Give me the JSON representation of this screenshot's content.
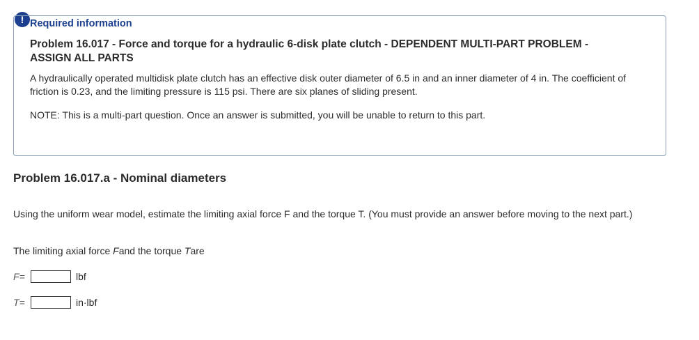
{
  "alert": {
    "icon": "exclamation-icon",
    "glyph": "!",
    "color": "#1d3f8f"
  },
  "info": {
    "required_label": "Required information",
    "problem_title": "Problem 16.017 - Force and torque for a hydraulic 6-disk plate clutch - DEPENDENT MULTI-PART PROBLEM - ASSIGN ALL PARTS",
    "description": "A hydraulically operated multidisk plate clutch has an effective disk outer diameter of 6.5 in and an inner diameter of 4 in. The coefficient of friction is 0.23, and the limiting pressure is 115 psi. There are six planes of sliding present.",
    "note": "NOTE: This is a multi-part question. Once an answer is submitted, you will be unable to return to this part."
  },
  "part": {
    "title": "Problem 16.017.a - Nominal diameters",
    "question": "Using the uniform wear model, estimate the limiting axial force F and the torque T. (You must provide an answer before moving to the next part.)",
    "prompt_prefix": "The limiting axial force ",
    "prompt_var_f": "F",
    "prompt_middle": "and the torque ",
    "prompt_var_t": "T",
    "prompt_suffix": "are"
  },
  "answers": [
    {
      "var": "F",
      "eq": "=",
      "value": "",
      "unit": "lbf"
    },
    {
      "var": "T",
      "eq": "=",
      "value": "",
      "unit": "in·lbf"
    }
  ]
}
